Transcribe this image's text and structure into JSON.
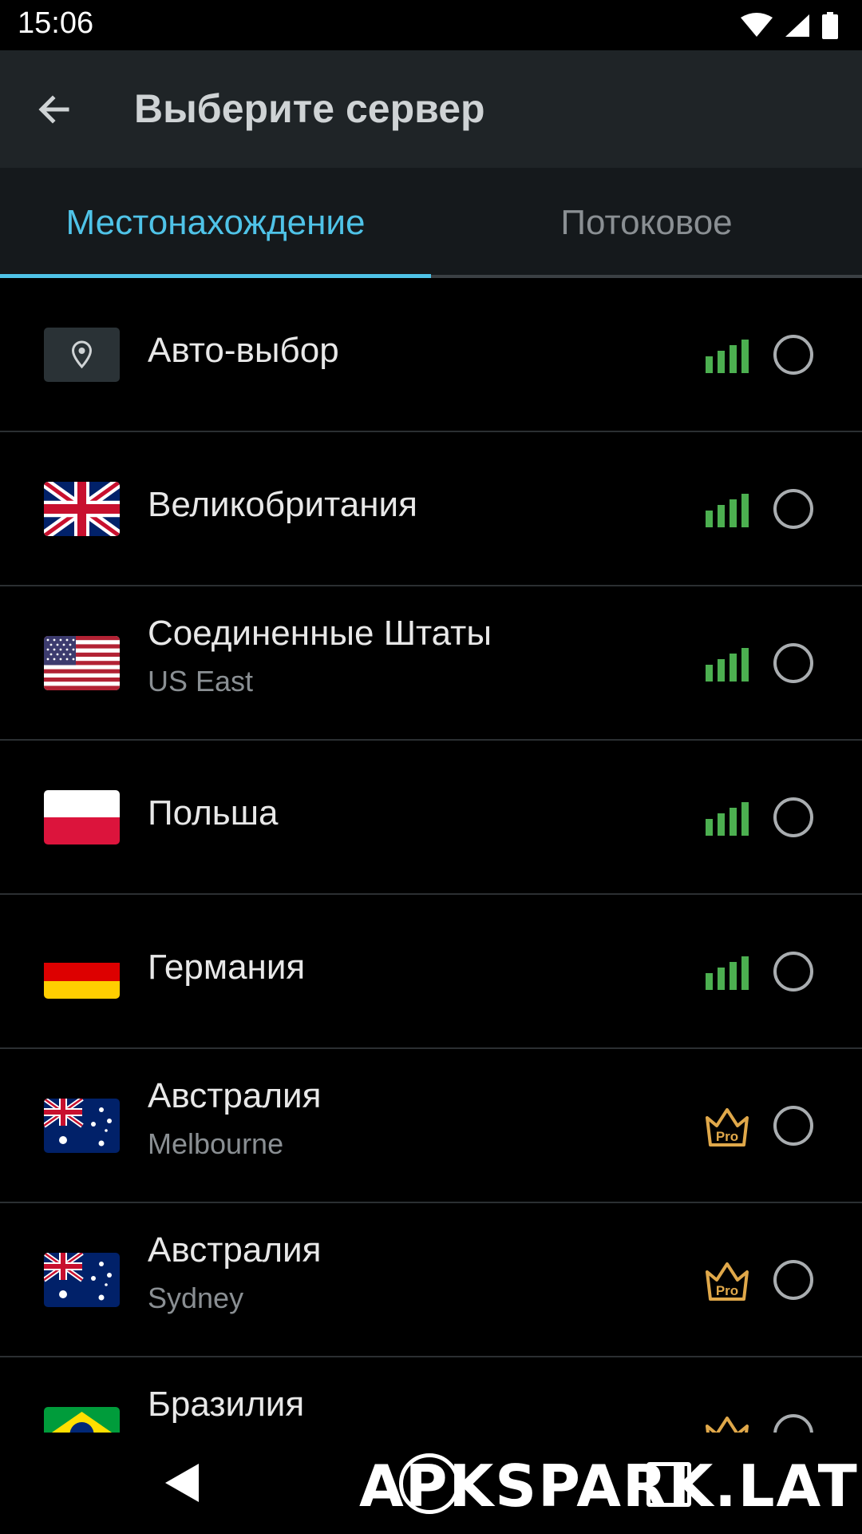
{
  "status_bar": {
    "time": "15:06"
  },
  "app_bar": {
    "title": "Выберите сервер"
  },
  "tabs": [
    {
      "label": "Местонахождение",
      "active": true
    },
    {
      "label": "Потоковое",
      "active": false
    }
  ],
  "servers": [
    {
      "name": "Авто-выбор",
      "sub": "",
      "flag": "location-pin",
      "badge": "signal"
    },
    {
      "name": "Великобритания",
      "sub": "",
      "flag": "uk",
      "badge": "signal"
    },
    {
      "name": "Соединенные Штаты",
      "sub": "US East",
      "flag": "us",
      "badge": "signal"
    },
    {
      "name": "Польша",
      "sub": "",
      "flag": "poland",
      "badge": "signal"
    },
    {
      "name": "Германия",
      "sub": "",
      "flag": "germany",
      "badge": "signal"
    },
    {
      "name": "Австралия",
      "sub": "Melbourne",
      "flag": "australia",
      "badge": "pro"
    },
    {
      "name": "Австралия",
      "sub": "Sydney",
      "flag": "australia",
      "badge": "pro"
    },
    {
      "name": "Бразилия",
      "sub": "",
      "flag": "brazil",
      "badge": "pro"
    }
  ],
  "pro_badge_text": "Pro",
  "colors": {
    "accent": "#4fc3e8",
    "signal": "#4caf50",
    "pro": "#e0a84a",
    "appbar": "#1f2427"
  },
  "watermark": "APKSPARK.LAT"
}
